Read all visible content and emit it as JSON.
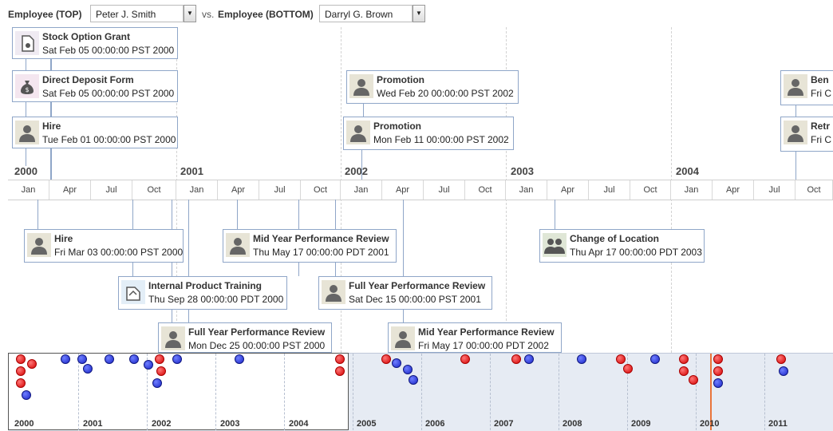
{
  "toolbar": {
    "top_label": "Employee (TOP)",
    "top_value": "Peter J. Smith",
    "vs": "vs.",
    "bottom_label": "Employee (BOTTOM)",
    "bottom_value": "Darryl G. Brown"
  },
  "axis": {
    "years": [
      "2000",
      "2001",
      "2002",
      "2003",
      "2004"
    ],
    "months": [
      "Jan",
      "Apr",
      "Jul",
      "Oct",
      "Jan",
      "Apr",
      "Jul",
      "Oct",
      "Jan",
      "Apr",
      "Jul",
      "Oct",
      "Jan",
      "Apr",
      "Jul",
      "Oct",
      "Jan",
      "Apr",
      "Jul",
      "Oct"
    ]
  },
  "top_events": [
    {
      "icon": "document-icon",
      "title": "Stock Option Grant",
      "date": "Sat Feb 05 00:00:00 PST 2000"
    },
    {
      "icon": "money-bag-icon",
      "title": "Direct Deposit Form",
      "date": "Sat Feb 05 00:00:00 PST 2000"
    },
    {
      "icon": "person-icon",
      "title": "Hire",
      "date": "Tue Feb 01 00:00:00 PST 2000"
    },
    {
      "icon": "person-icon",
      "title": "Promotion",
      "date": "Wed Feb 20 00:00:00 PST 2002"
    },
    {
      "icon": "person-icon",
      "title": "Promotion",
      "date": "Mon Feb 11 00:00:00 PST 2002"
    },
    {
      "icon": "person-icon",
      "title": "Ben",
      "date": "Fri C"
    },
    {
      "icon": "person-icon",
      "title": "Retr",
      "date": "Fri C"
    }
  ],
  "bottom_events": [
    {
      "icon": "person-icon",
      "title": "Hire",
      "date": "Fri Mar 03 00:00:00 PST 2000"
    },
    {
      "icon": "person-icon",
      "title": "Mid Year Performance Review",
      "date": "Thu May 17 00:00:00 PDT 2001"
    },
    {
      "icon": "group-icon",
      "title": "Change of Location",
      "date": "Thu Apr 17 00:00:00 PDT 2003"
    },
    {
      "icon": "training-icon",
      "title": "Internal Product Training",
      "date": "Thu Sep 28 00:00:00 PDT 2000"
    },
    {
      "icon": "person-icon",
      "title": "Full Year Performance Review",
      "date": "Sat Dec 15 00:00:00 PST 2001"
    },
    {
      "icon": "person-icon",
      "title": "Full Year Performance Review",
      "date": "Mon Dec 25 00:00:00 PST 2000"
    },
    {
      "icon": "person-icon",
      "title": "Mid Year Performance Review",
      "date": "Fri May 17 00:00:00 PDT 2002"
    }
  ],
  "overview": {
    "years": [
      "2000",
      "2001",
      "2002",
      "2003",
      "2004",
      "2005",
      "2006",
      "2007",
      "2008",
      "2009",
      "2010",
      "2011"
    ]
  },
  "colors": {
    "top_series": "#d40000",
    "bottom_series": "#1a25c8",
    "accent": "#e9743a"
  }
}
